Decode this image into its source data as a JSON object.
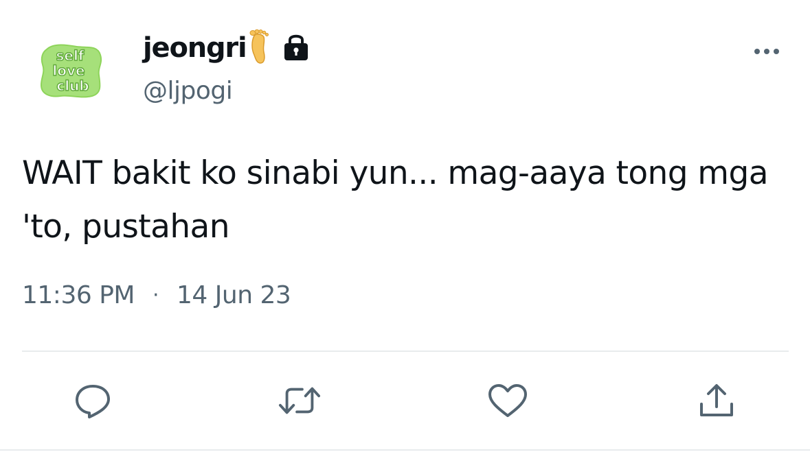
{
  "tweet": {
    "display_name": "jeongri",
    "handle": "@ljpogi",
    "text": "WAIT bakit ko sinabi yun... mag-aaya tong mga 'to, pustahan",
    "time": "11:36 PM",
    "separator": "·",
    "date": "14 Jun 23",
    "avatar_lines": [
      "self",
      "love",
      "club"
    ]
  },
  "icons": {
    "name_emoji": "foot-emoji",
    "protected": "lock-icon",
    "more": "more-horizontal-icon",
    "reply": "reply-icon",
    "retweet": "retweet-icon",
    "like": "heart-icon",
    "share": "share-icon"
  },
  "colors": {
    "text_primary": "#0f1419",
    "text_secondary": "#536471",
    "divider": "#e8ebed",
    "avatar_green": "#8ed45a",
    "avatar_text": "#5fa83a"
  }
}
